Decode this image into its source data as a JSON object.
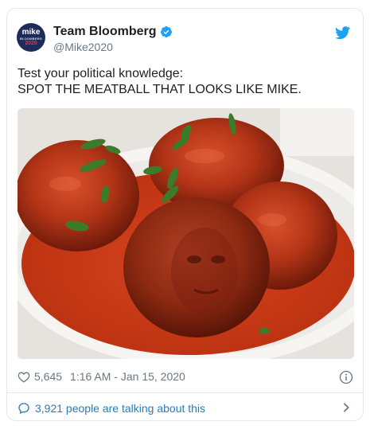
{
  "account": {
    "display_name": "Team Bloomberg",
    "handle": "@Mike2020",
    "avatar_text_top": "mike",
    "avatar_text_mid": "BLOOMBERG",
    "avatar_text_bottom": "2020"
  },
  "tweet": {
    "line1": "Test your political knowledge:",
    "line2": "SPOT THE MEATBALL THAT LOOKS LIKE MIKE.",
    "media_icon": "meatballs-photo"
  },
  "footer": {
    "likes": "5,645",
    "timestamp": "1:16 AM - Jan 15, 2020",
    "talking": "3,921 people are talking about this"
  },
  "colors": {
    "twitter_blue": "#1da1f2",
    "link_blue": "#2b7bb9",
    "muted": "#697882",
    "sauce": "#c23a1c"
  }
}
